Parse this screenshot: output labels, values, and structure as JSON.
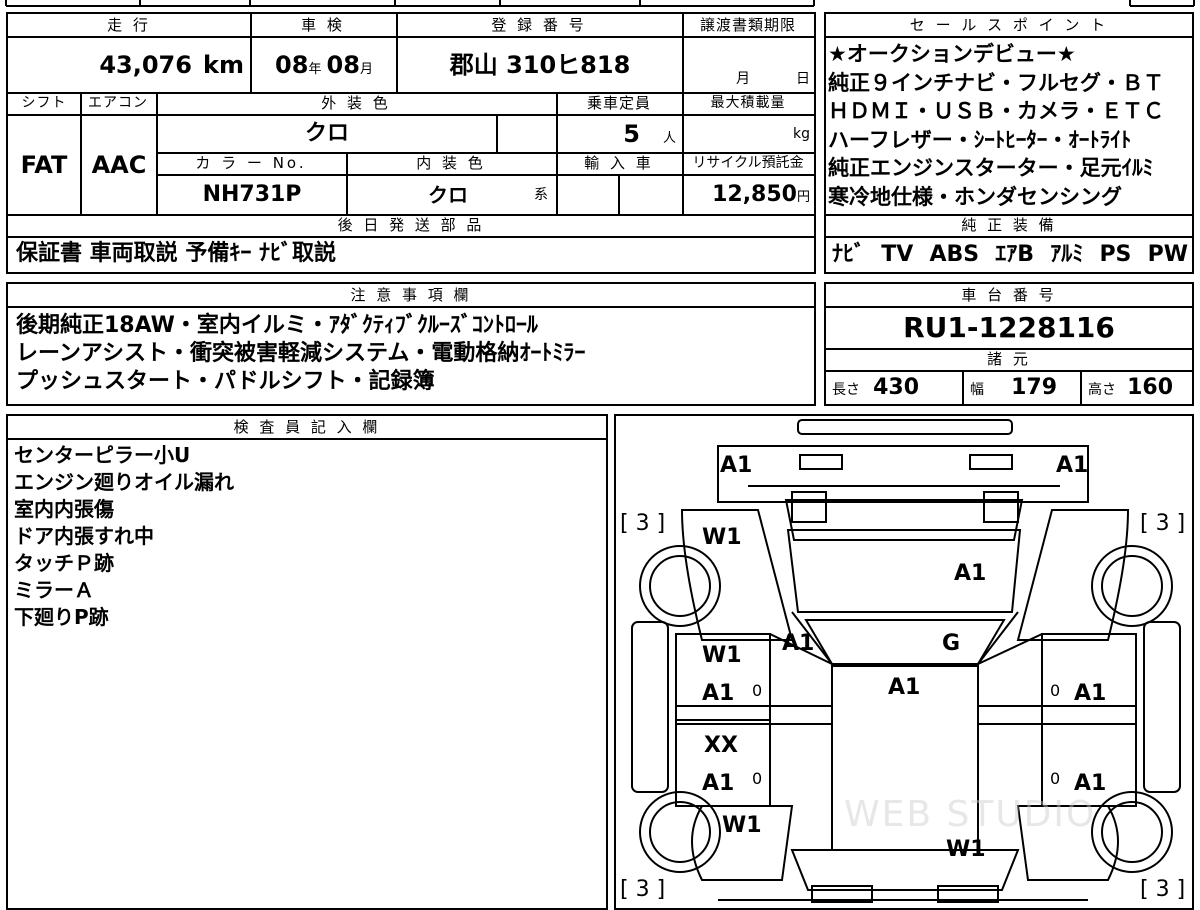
{
  "vehicle": {
    "mileage_label": "走 行",
    "mileage_value": "43,076",
    "mileage_unit": "km",
    "inspection_label": "車 検",
    "inspection_year": "08",
    "inspection_year_unit": "年",
    "inspection_month": "08",
    "inspection_month_unit": "月",
    "registration_label": "登 録 番 号",
    "registration_value": "郡山 310ヒ818",
    "transfer_label": "譲渡書類期限",
    "transfer_month_unit": "月",
    "transfer_day_unit": "日",
    "shift_label": "シフト",
    "shift_value": "FAT",
    "ac_label": "エアコン",
    "ac_value": "AAC",
    "exterior_color_label": "外 装 色",
    "exterior_color_value": "クロ",
    "capacity_label": "乗車定員",
    "capacity_value": "5",
    "capacity_unit": "人",
    "max_load_label": "最大積載量",
    "max_load_unit": "kg",
    "color_no_label": "カ ラ ー No.",
    "color_no_value": "NH731P",
    "interior_color_label": "内 装 色",
    "interior_color_value": "クロ",
    "interior_color_suffix": "系",
    "import_label": "輸 入 車",
    "recycle_label": "リサイクル預託金",
    "recycle_value": "12,850",
    "recycle_unit": "円"
  },
  "later_parts": {
    "label": "後 日 発 送 部 品",
    "value": "保証書 車両取説 予備ｷｰ ﾅﾋﾞ取説"
  },
  "sales_points": {
    "label": "セ ー ル ス ポ イ ン ト",
    "lines": [
      "★オークションデビュー★",
      "純正９インチナビ・フルセグ・ＢＴ",
      "ＨＤＭＩ・ＵＳＢ・カメラ・ＥＴＣ",
      "ハーフレザー・ｼｰﾄﾋｰﾀｰ・ｵｰﾄﾗｲﾄ",
      "純正エンジンスターター・足元ｲﾙﾐ",
      "寒冷地仕様・ホンダセンシング"
    ]
  },
  "genuine_equipment": {
    "label": "純 正 装 備",
    "items": [
      "ﾅﾋﾞ",
      "TV",
      "ABS",
      "ｴｱB",
      "ｱﾙﾐ",
      "PS",
      "PW"
    ]
  },
  "notes": {
    "label": "注 意 事 項 欄",
    "lines": [
      "後期純正18AW・室内イルミ・ｱﾀﾞｸﾃｨﾌﾞｸﾙｰｽﾞｺﾝﾄﾛｰﾙ",
      "レーンアシスト・衝突被害軽減システム・電動格納ｵｰﾄﾐﾗｰ",
      "プッシュスタート・パドルシフト・記録簿"
    ]
  },
  "chassis": {
    "label": "車 台 番 号",
    "value": "RU1-1228116"
  },
  "specs": {
    "label": "諸 元",
    "length_label": "長さ",
    "length_value": "430",
    "width_label": "幅",
    "width_value": "179",
    "height_label": "高さ",
    "height_value": "160"
  },
  "inspector": {
    "label": "検 査 員 記 入 欄",
    "lines": [
      "センターピラー小U",
      "エンジン廻りオイル漏れ",
      "室内内張傷",
      "ドア内張すれ中",
      "タッチＰ跡",
      "ミラーＡ",
      "下廻りP跡"
    ]
  },
  "diagram": {
    "marks": {
      "front_left_corner": "A1",
      "front_right_corner": "A1",
      "tire_fl": "[ 3 ]",
      "tire_fr": "[ 3 ]",
      "tire_rl": "[ 3 ]",
      "tire_rr": "[ 3 ]",
      "wheel_fl": "W1",
      "hood": "A1",
      "a_pillar": "A1",
      "windshield": "G",
      "roof": "A1",
      "front_door_left_1": "W1",
      "front_door_left_2": "A1",
      "front_door_left_zero": "0",
      "front_door_right": "A1",
      "front_door_right_zero": "0",
      "rear_door_left_1": "XX",
      "rear_door_left_2": "A1",
      "rear_door_left_zero": "0",
      "rear_door_right": "A1",
      "rear_door_right_zero": "0",
      "wheel_rl": "W1",
      "wheel_rr": "W1"
    },
    "watermark": "WEB STUDIO"
  }
}
